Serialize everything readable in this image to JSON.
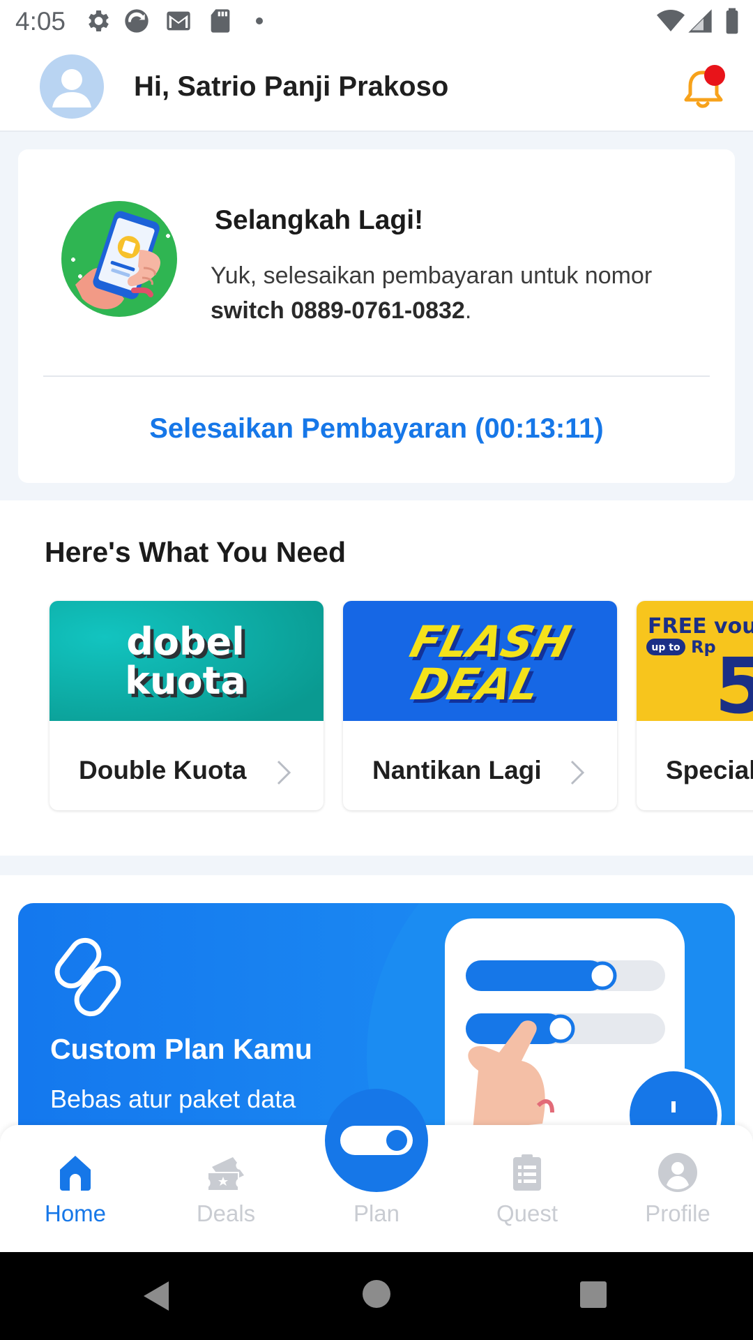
{
  "status_bar": {
    "time": "4:05",
    "left_icons": [
      "gear-icon",
      "sync-icon",
      "gmail-icon",
      "sd-card-icon",
      "dot-icon"
    ],
    "right_icons": [
      "wifi-icon",
      "signal-icon",
      "battery-icon"
    ]
  },
  "header": {
    "greeting": "Hi, Satrio Panji Prakoso",
    "notification_badge": true
  },
  "pending_card": {
    "title": "Selangkah Lagi!",
    "text_prefix": "Yuk, selesaikan pembayaran untuk nomor ",
    "text_bold": "switch 0889-0761-0832",
    "text_suffix": ".",
    "cta": "Selesaikan Pembayaran (00:13:11)"
  },
  "section": {
    "title": "Here's What You Need"
  },
  "promos": [
    {
      "banner_line1": "dobel",
      "banner_line2": "kuota",
      "label": "Double Kuota"
    },
    {
      "banner_line1": "FLASH",
      "banner_line2": "DEAL",
      "label": "Nantikan Lagi"
    },
    {
      "banner_line1": "FREE vou",
      "banner_small": "up to",
      "banner_rp": "Rp",
      "banner_num": "5",
      "label": "Special"
    }
  ],
  "plan_banner": {
    "title": "Custom Plan Kamu",
    "subtitle": "Bebas atur paket data"
  },
  "bottom_nav": {
    "items": [
      {
        "label": "Home",
        "active": true
      },
      {
        "label": "Deals",
        "active": false
      },
      {
        "label": "Plan",
        "active": false
      },
      {
        "label": "Quest",
        "active": false
      },
      {
        "label": "Profile",
        "active": false
      }
    ]
  },
  "colors": {
    "primary": "#1677e8",
    "notification_dot": "#e8141a",
    "bell": "#f7a21b",
    "inactive_nav": "#c9ccd2"
  }
}
